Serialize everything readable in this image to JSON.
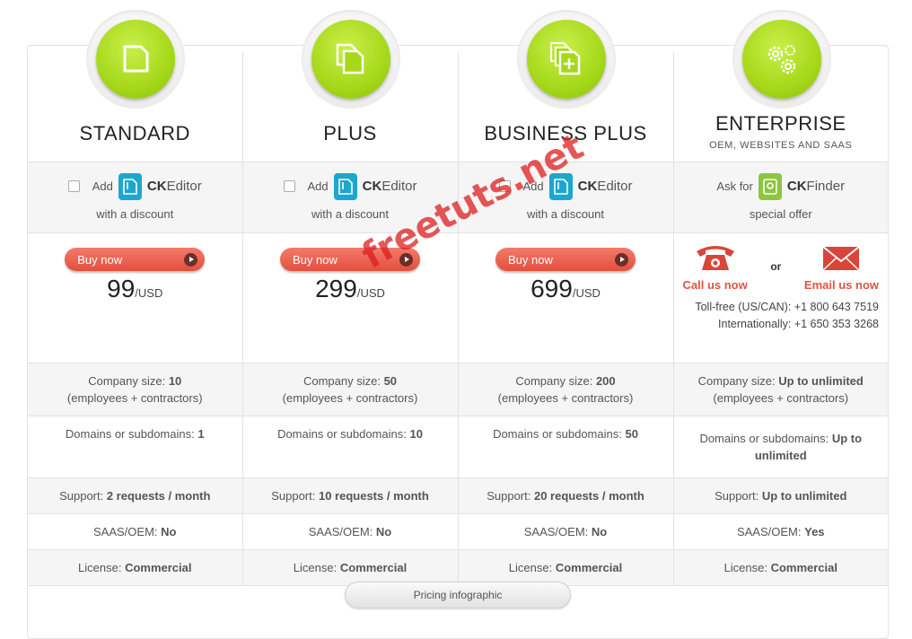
{
  "plans": [
    {
      "title": "STANDARD",
      "subtitle": "",
      "price": "99",
      "currency": "/USD",
      "company_size": "10",
      "domains": "1",
      "support": "2 requests / month",
      "saas": "No",
      "license": "Commercial"
    },
    {
      "title": "PLUS",
      "subtitle": "",
      "price": "299",
      "currency": "/USD",
      "company_size": "50",
      "domains": "10",
      "support": "10 requests / month",
      "saas": "No",
      "license": "Commercial"
    },
    {
      "title": "BUSINESS PLUS",
      "subtitle": "",
      "price": "699",
      "currency": "/USD",
      "company_size": "200",
      "domains": "50",
      "support": "20 requests / month",
      "saas": "No",
      "license": "Commercial"
    },
    {
      "title": "ENTERPRISE",
      "subtitle": "OEM, WEBSITES AND SAAS",
      "company_size": "Up to unlimited",
      "domains": "Up to unlimited",
      "support": "Up to unlimited",
      "saas": "Yes",
      "license": "Commercial"
    }
  ],
  "labels": {
    "add": "Add",
    "ck_prefix": "CK",
    "ckeditor": "Editor",
    "ckfinder": "Finder",
    "with_discount": "with a discount",
    "ask_for": "Ask for",
    "special_offer": "special offer",
    "buy_now": "Buy now",
    "company_size": "Company size: ",
    "employees": "(employees + contractors)",
    "domains": "Domains or subdomains: ",
    "support": "Support: ",
    "saas": "SAAS/OEM: ",
    "license": "License: "
  },
  "contact": {
    "call": "Call us now",
    "or": "or",
    "email": "Email us now",
    "tollfree_label": "Toll-free (US/CAN): ",
    "tollfree": "+1 800 643 7519",
    "intl_label": "Internationally: ",
    "intl": "+1 650 353 3268"
  },
  "footer_button": "Pricing infographic",
  "watermark": "freetuts.net",
  "colors": {
    "accent_green": "#a6d81a",
    "buy_red": "#e2503d",
    "link_red": "#e0533f",
    "ckeditor_blue": "#1da6ce",
    "ckfinder_green": "#8cc63f"
  },
  "icons": [
    "single-page-icon",
    "two-pages-icon",
    "pages-plus-icon",
    "gears-icon",
    "telephone-icon",
    "envelope-icon",
    "play-icon",
    "checkbox-icon"
  ]
}
